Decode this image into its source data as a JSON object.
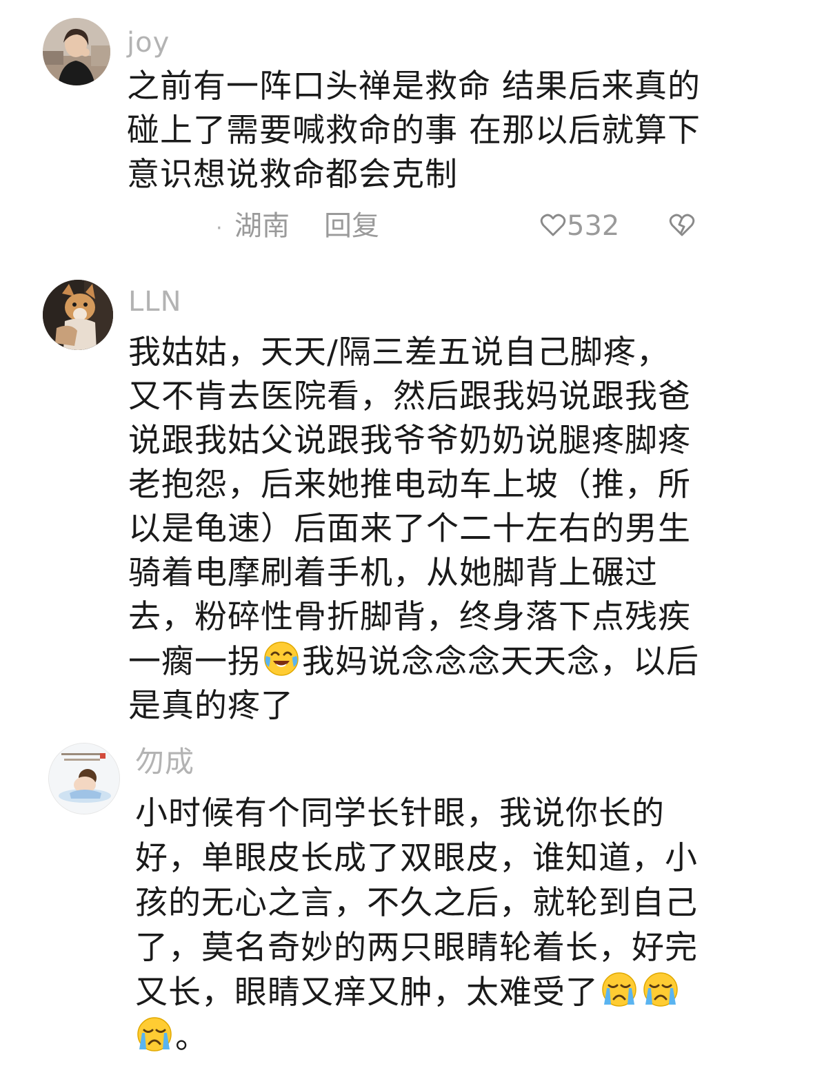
{
  "comments": [
    {
      "username": "joy",
      "lines": [
        "之前有一阵口头禅是救命 结果后来真的",
        "碰上了需要喊救命的事 在那以后就算下",
        "意识想说救命都会克制"
      ],
      "location": "湖南",
      "reply_label": "回复",
      "like_count": "532",
      "avatar_icon": "woman-photo-avatar",
      "like_icon": "heart-outline-icon",
      "dislike_icon": "broken-heart-icon"
    },
    {
      "username": "LLN",
      "lines": [
        "我姑姑，天天/隔三差五说自己脚疼，",
        "又不肯去医院看，然后跟我妈说跟我爸",
        "说跟我姑父说跟我爷爷奶奶说腿疼脚疼",
        "老抱怨，后来她推电动车上坡（推，所",
        "以是龟速）后面来了个二十左右的男生",
        "骑着电摩刷着手机，从她脚背上碾过",
        "去，粉碎性骨折脚背，终身落下点残疾"
      ],
      "line8_before_emoji": "一瘸一拐",
      "line8_after_emoji": "我妈说念念念天天念，以后",
      "line9": "是真的疼了",
      "avatar_icon": "dog-photo-avatar",
      "emoji_icon": "tears-of-joy-emoji"
    },
    {
      "username": "勿成",
      "lines": [
        "小时候有个同学长针眼，我说你长的",
        "好，单眼皮长成了双眼皮，谁知道，小",
        "孩的无心之言，不久之后，就轮到自己",
        "了，莫名奇妙的两只眼睛轮着长，好完"
      ],
      "line5_before_emoji": "又长，眼睛又痒又肿，太难受了",
      "line6_after_emoji": "。",
      "avatar_icon": "baby-illustration-avatar",
      "emoji_icon": "crying-face-emoji"
    }
  ],
  "colors": {
    "text": "#1a1a1a",
    "username": "#b3b3b3",
    "meta": "#9a9a9a"
  }
}
